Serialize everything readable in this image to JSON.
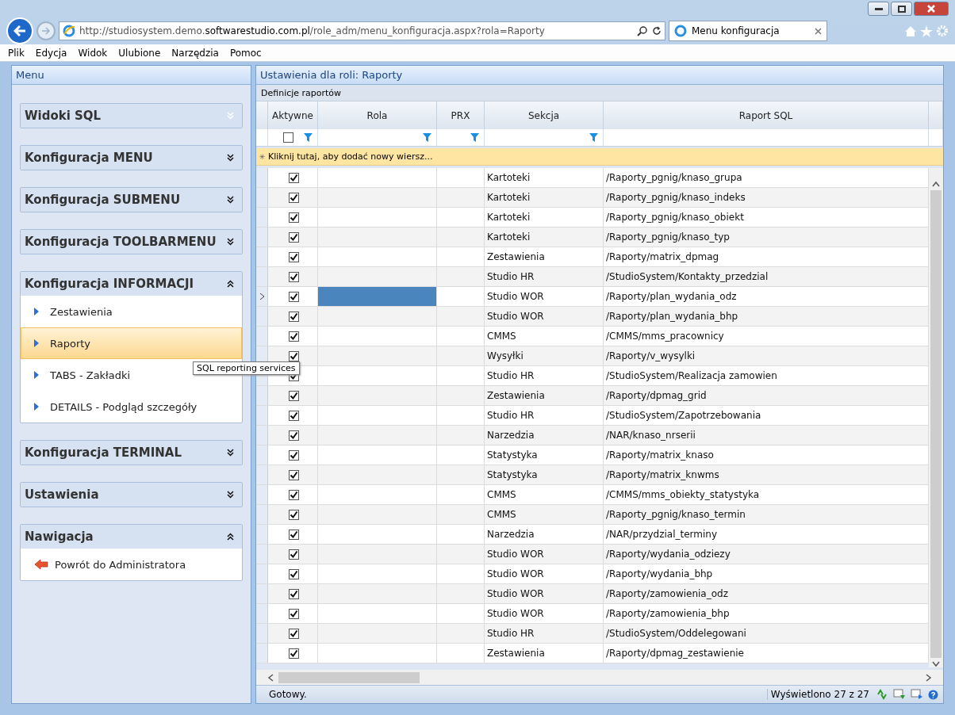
{
  "browser": {
    "url_parts": [
      "http://studiosystem.demo.",
      "softwarestudio.com.pl",
      "/role_adm/menu_konfiguracja.aspx?rola=Raporty"
    ],
    "tab_title": "Menu konfiguracja",
    "menu": [
      "Plik",
      "Edycja",
      "Widok",
      "Ulubione",
      "Narzędzia",
      "Pomoc"
    ]
  },
  "sidebar": {
    "title": "Menu",
    "groups": [
      {
        "title": "Widoki SQL",
        "expanded": false,
        "disabled": true
      },
      {
        "title": "Konfiguracja MENU",
        "expanded": false,
        "disabled": false
      },
      {
        "title": "Konfiguracja SUBMENU",
        "expanded": false,
        "disabled": false
      },
      {
        "title": "Konfiguracja TOOLBARMENU",
        "expanded": false,
        "disabled": false
      },
      {
        "title": "Konfiguracja INFORMACJI",
        "expanded": true,
        "disabled": false,
        "items": [
          {
            "label": "Zestawienia",
            "kind": "link",
            "selected": false
          },
          {
            "label": "Raporty",
            "kind": "link",
            "selected": true
          },
          {
            "label": "TABS - Zakładki",
            "kind": "link",
            "selected": false
          },
          {
            "label": "DETAILS - Podgląd szczegóły",
            "kind": "link",
            "selected": false
          }
        ]
      },
      {
        "title": "Konfiguracja TERMINAL",
        "expanded": false,
        "disabled": false
      },
      {
        "title": "Ustawienia",
        "expanded": false,
        "disabled": false
      },
      {
        "title": "Nawigacja",
        "expanded": true,
        "disabled": false,
        "items": [
          {
            "label": "Powrót do Administratora",
            "kind": "back",
            "selected": false
          }
        ]
      }
    ]
  },
  "tooltip": "SQL reporting services",
  "main": {
    "title": "Ustawienia dla roli: Raporty",
    "grid_caption": "Definicje raportów",
    "columns": [
      "Aktywne",
      "Rola",
      "PRX",
      "Sekcja",
      "Raport SQL"
    ],
    "filter_checked": false,
    "new_row_marker": "✳",
    "new_row": "Kliknij tutaj, aby dodać nowy wiersz...",
    "rows": [
      {
        "active": true,
        "selected": false,
        "sekcja": "Kartoteki",
        "raport": "/Raporty_pgnig/knaso_grupa"
      },
      {
        "active": true,
        "selected": false,
        "sekcja": "Kartoteki",
        "raport": "/Raporty_pgnig/knaso_indeks"
      },
      {
        "active": true,
        "selected": false,
        "sekcja": "Kartoteki",
        "raport": "/Raporty_pgnig/knaso_obiekt"
      },
      {
        "active": true,
        "selected": false,
        "sekcja": "Kartoteki",
        "raport": "/Raporty_pgnig/knaso_typ"
      },
      {
        "active": true,
        "selected": false,
        "sekcja": "Zestawienia",
        "raport": "/Raporty/matrix_dpmag"
      },
      {
        "active": true,
        "selected": false,
        "sekcja": "Studio HR",
        "raport": "/StudioSystem/Kontakty_przedzial"
      },
      {
        "active": true,
        "selected": true,
        "sekcja": "Studio WOR",
        "raport": "/Raporty/plan_wydania_odz"
      },
      {
        "active": true,
        "selected": false,
        "sekcja": "Studio WOR",
        "raport": "/Raporty/plan_wydania_bhp"
      },
      {
        "active": true,
        "selected": false,
        "sekcja": "CMMS",
        "raport": "/CMMS/mms_pracownicy"
      },
      {
        "active": true,
        "selected": false,
        "sekcja": "Wysyłki",
        "raport": "/Raporty/v_wysylki"
      },
      {
        "active": true,
        "selected": false,
        "sekcja": "Studio HR",
        "raport": "/StudioSystem/Realizacja zamowien"
      },
      {
        "active": true,
        "selected": false,
        "sekcja": "Zestawienia",
        "raport": "/Raporty/dpmag_grid"
      },
      {
        "active": true,
        "selected": false,
        "sekcja": "Studio HR",
        "raport": "/StudioSystem/Zapotrzebowania"
      },
      {
        "active": true,
        "selected": false,
        "sekcja": "Narzedzia",
        "raport": "/NAR/knaso_nrserii"
      },
      {
        "active": true,
        "selected": false,
        "sekcja": "Statystyka",
        "raport": "/Raporty/matrix_knaso"
      },
      {
        "active": true,
        "selected": false,
        "sekcja": "Statystyka",
        "raport": "/Raporty/matrix_knwms"
      },
      {
        "active": true,
        "selected": false,
        "sekcja": "CMMS",
        "raport": "/CMMS/mms_obiekty_statystyka"
      },
      {
        "active": true,
        "selected": false,
        "sekcja": "CMMS",
        "raport": "/Raporty_pgnig/knaso_termin"
      },
      {
        "active": true,
        "selected": false,
        "sekcja": "Narzedzia",
        "raport": "/NAR/przydzial_terminy"
      },
      {
        "active": true,
        "selected": false,
        "sekcja": "Studio WOR",
        "raport": "/Raporty/wydania_odziezy"
      },
      {
        "active": true,
        "selected": false,
        "sekcja": "Studio WOR",
        "raport": "/Raporty/wydania_bhp"
      },
      {
        "active": true,
        "selected": false,
        "sekcja": "Studio WOR",
        "raport": "/Raporty/zamowienia_odz"
      },
      {
        "active": true,
        "selected": false,
        "sekcja": "Studio WOR",
        "raport": "/Raporty/zamowienia_bhp"
      },
      {
        "active": true,
        "selected": false,
        "sekcja": "Studio HR",
        "raport": "/StudioSystem/Oddelegowani"
      },
      {
        "active": true,
        "selected": false,
        "sekcja": "Zestawienia",
        "raport": "/Raporty/dpmag_zestawienie"
      }
    ],
    "status": "Gotowy.",
    "count": "Wyświetlono 27 z 27"
  }
}
